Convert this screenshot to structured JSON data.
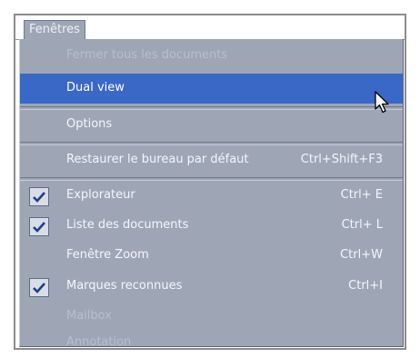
{
  "menu_title": "Fenêtres",
  "items": [
    {
      "label": "Fermer tous les documents",
      "shortcut": "",
      "checked": false,
      "disabled": true,
      "highlight": false
    },
    {
      "label": "Dual view",
      "shortcut": "",
      "checked": false,
      "disabled": false,
      "highlight": true
    },
    {
      "label": "Options",
      "shortcut": "",
      "checked": false,
      "disabled": false,
      "highlight": false
    },
    {
      "label": "Restaurer le bureau par défaut",
      "shortcut": "Ctrl+Shift+F3",
      "checked": false,
      "disabled": false,
      "highlight": false
    },
    {
      "label": "Explorateur",
      "shortcut": "Ctrl+ E",
      "checked": true,
      "disabled": false,
      "highlight": false
    },
    {
      "label": "Liste des documents",
      "shortcut": "Ctrl+ L",
      "checked": true,
      "disabled": false,
      "highlight": false
    },
    {
      "label": "Fenêtre Zoom",
      "shortcut": "Ctrl+W",
      "checked": false,
      "disabled": false,
      "highlight": false
    },
    {
      "label": "Marques reconnues",
      "shortcut": "Ctrl+I",
      "checked": true,
      "disabled": false,
      "highlight": false
    },
    {
      "label": "Mailbox",
      "shortcut": "",
      "checked": false,
      "disabled": true,
      "highlight": false
    },
    {
      "label": "Annotation",
      "shortcut": "",
      "checked": false,
      "disabled": true,
      "highlight": false
    }
  ],
  "icons": {
    "check": "checkmark-icon",
    "cursor": "mouse-pointer-icon"
  },
  "colors": {
    "menu_bg": "#9ea6b6",
    "highlight": "#3a68c7",
    "text": "#f4f6fb",
    "disabled_text": "#b8bfcb"
  }
}
